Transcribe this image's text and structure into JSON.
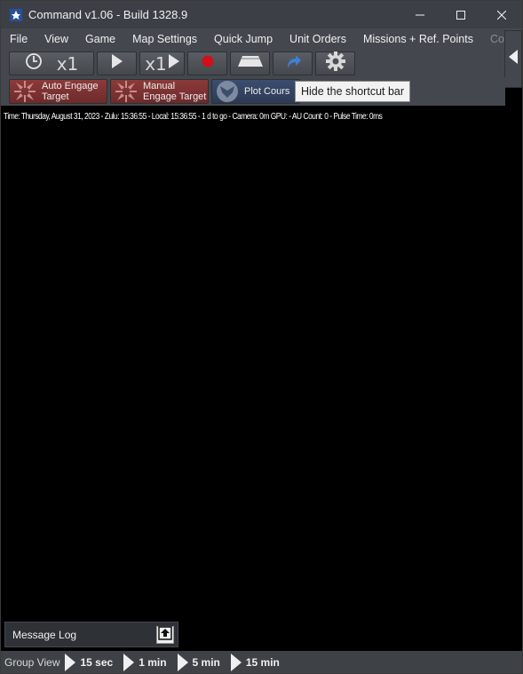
{
  "window": {
    "title": "Command v1.06 - Build 1328.9",
    "minimize_glyph": "—",
    "maximize_glyph": "☐",
    "close_glyph": "✕"
  },
  "menu": [
    "File",
    "View",
    "Game",
    "Map Settings",
    "Quick Jump",
    "Unit Orders",
    "Missions + Ref. Points",
    "Contact"
  ],
  "toolbar": {
    "time_compression_label": "x1",
    "speed_label": "x1",
    "icons": [
      "clock-icon",
      "play-icon",
      "step-play-icon",
      "record-icon",
      "layer-icon",
      "jump-icon",
      "gear-icon",
      "collapse-arrow-icon"
    ]
  },
  "shortcuts": [
    {
      "label": "Auto Engage\nTarget",
      "icon": "crosshair-arrows-icon",
      "color": "#7a3232"
    },
    {
      "label": "Manual\nEngage Target",
      "icon": "crosshair-arrows-icon",
      "color": "#7a3232"
    },
    {
      "label": "Plot Cours",
      "icon": "plot-course-icon",
      "color": "#34466a"
    }
  ],
  "tooltip": "Hide the shortcut bar",
  "status_line": "Time: Thursday, August 31, 2023 - Zulu: 15:36:55 - Local: 15:36:55 - 1 d to go -  Camera: 0m  GPU:  - AU Count: 0 - Pulse Time: 0ms",
  "message_log": {
    "label": "Message Log"
  },
  "group_view": {
    "label": "Group View",
    "options": [
      "15 sec",
      "1 min",
      "5 min",
      "15 min"
    ]
  },
  "colors": {
    "chrome": "#44484e",
    "title": "#3c4046",
    "map_bg": "#000000",
    "record": "#d0101a"
  }
}
